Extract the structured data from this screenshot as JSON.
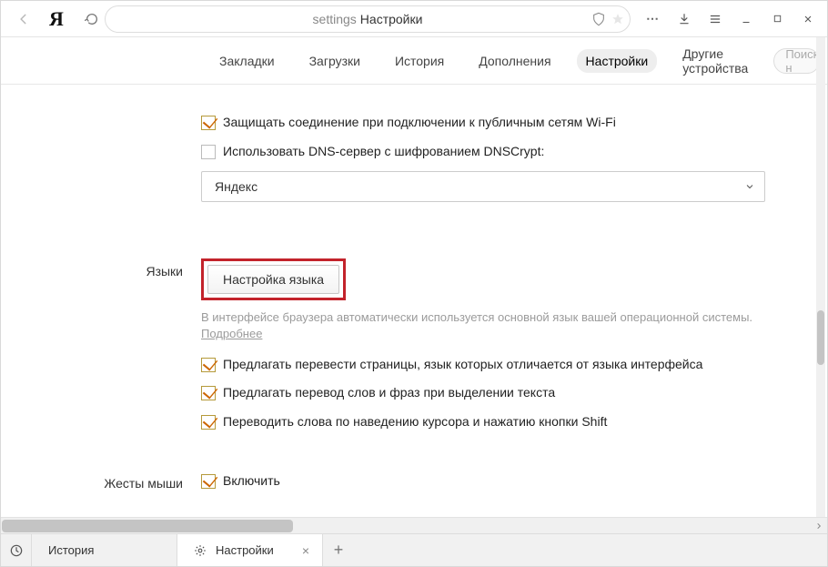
{
  "titlebar": {
    "address_left": "settings",
    "address_right": "Настройки"
  },
  "tabs": {
    "bookmarks": "Закладки",
    "downloads": "Загрузки",
    "history": "История",
    "extensions": "Дополнения",
    "settings": "Настройки",
    "other_devices": "Другие устройства",
    "search_placeholder": "Поиск н"
  },
  "security": {
    "protect_wifi": "Защищать соединение при подключении к публичным сетям Wi-Fi",
    "use_dnscrypt": "Использовать DNS-сервер с шифрованием DNSCrypt:",
    "dns_selected": "Яндекс"
  },
  "languages": {
    "section_label": "Языки",
    "configure_button": "Настройка языка",
    "hint_text": "В интерфейсе браузера автоматически используется основной язык вашей операционной системы. ",
    "hint_link": "Подробнее",
    "translate_pages": "Предлагать перевести страницы, язык которых отличается от языка интерфейса",
    "translate_selection": "Предлагать перевод слов и фраз при выделении текста",
    "translate_hover": "Переводить слова по наведению курсора и нажатию кнопки Shift"
  },
  "mouse": {
    "section_label": "Жесты мыши",
    "enable": "Включить"
  },
  "bottom_tabs": {
    "history": "История",
    "settings": "Настройки"
  }
}
